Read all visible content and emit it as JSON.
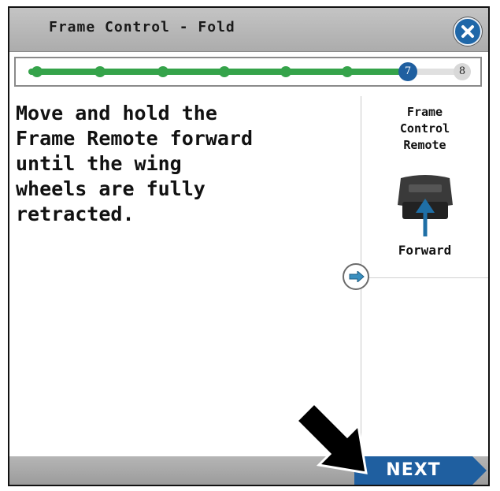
{
  "window": {
    "title": "Frame Control - Fold"
  },
  "progress": {
    "current_step": "7",
    "last_step": "8",
    "completed_fraction": 0.857
  },
  "instruction": {
    "text": "Move and hold the\nFrame Remote forward\nuntil the wing\nwheels are fully\nretracted."
  },
  "side_panel": {
    "title": "Frame\nControl\nRemote",
    "direction_label": "Forward"
  },
  "footer": {
    "next_label": "NEXT"
  },
  "colors": {
    "accent": "#1f5fa0",
    "progress": "#35a34a",
    "titlebar": "#b8b8b8"
  },
  "icons": {
    "close": "close-x-icon",
    "expand": "arrow-right-icon",
    "remote": "frame-remote-icon",
    "pointer": "pointer-arrow-icon"
  }
}
